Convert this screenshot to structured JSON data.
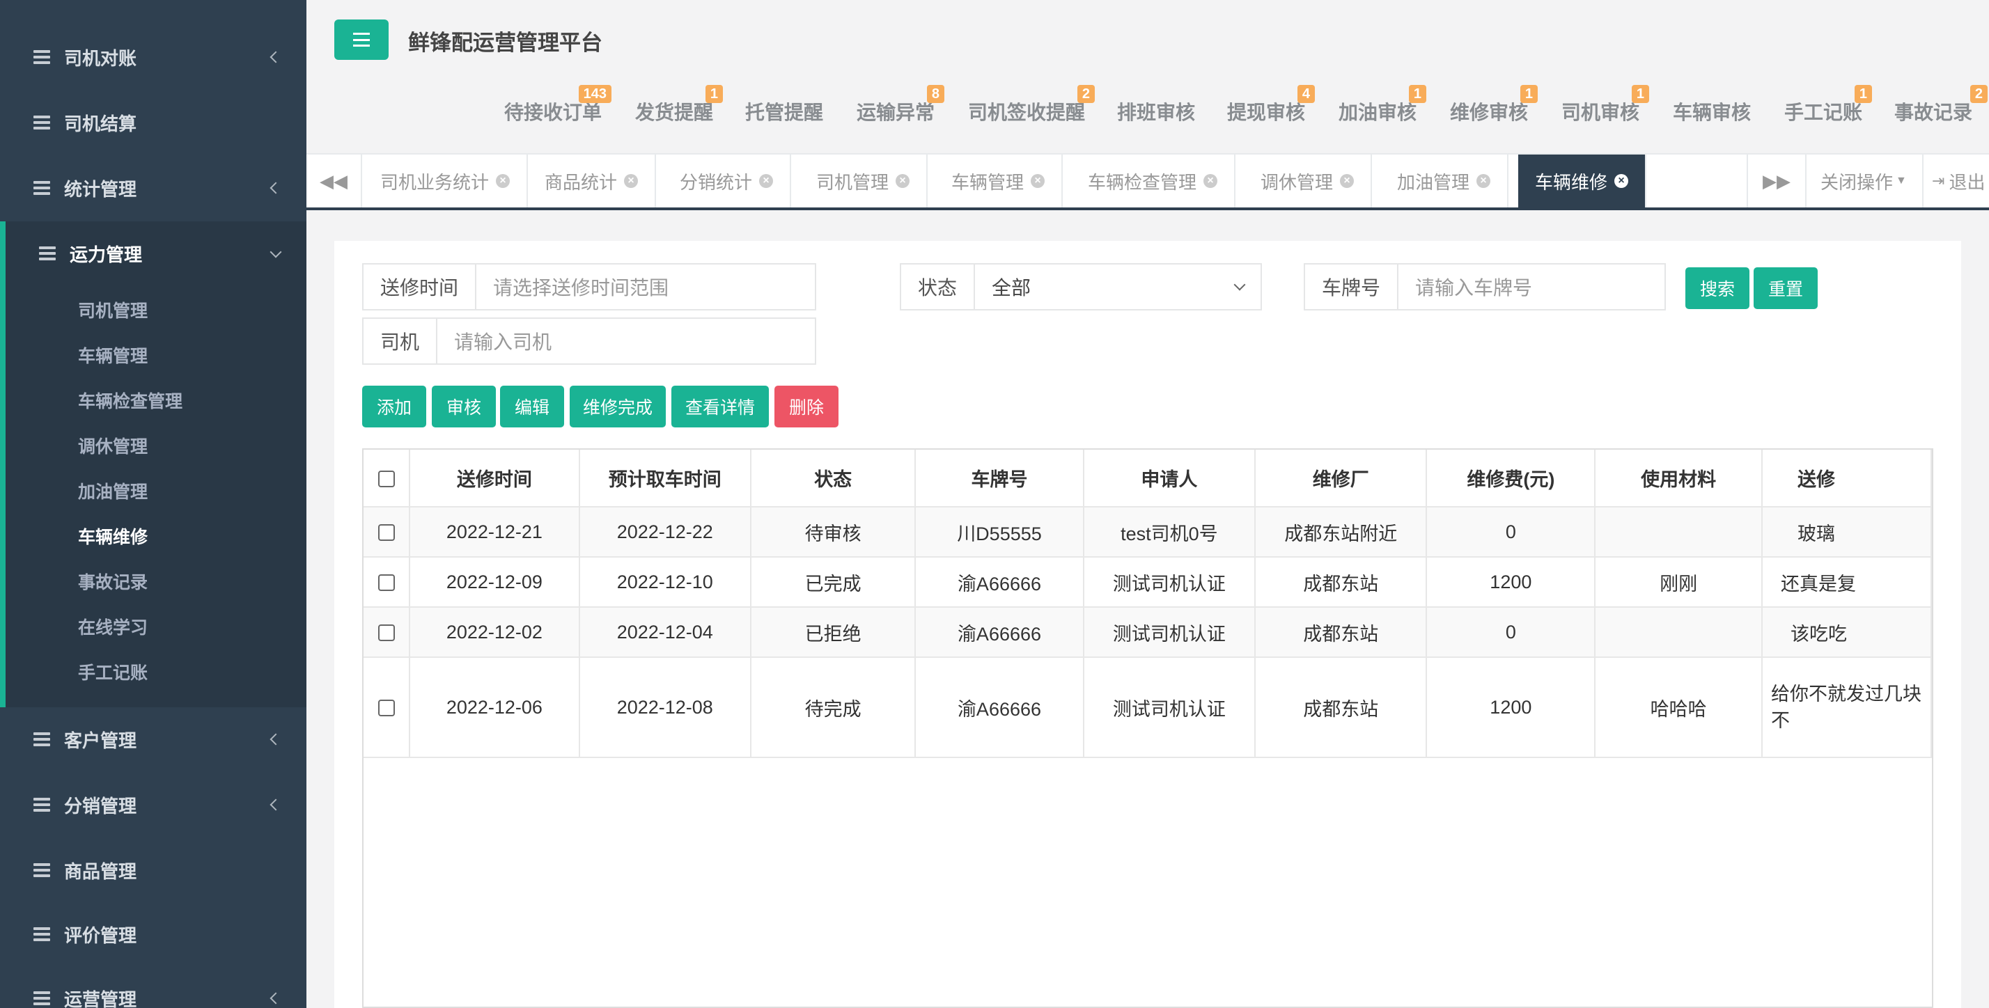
{
  "app_title": "鲜锋配运营管理平台",
  "colors": {
    "sidebar_bg": "#2f4050",
    "accent": "#1ab394",
    "danger": "#ed5565",
    "badge": "#f8ac59"
  },
  "sidebar": {
    "items": [
      {
        "label": "司机对账",
        "has_children": true
      },
      {
        "label": "司机结算",
        "has_children": false
      },
      {
        "label": "统计管理",
        "has_children": true
      },
      {
        "label": "运力管理",
        "has_children": true,
        "expanded": true
      },
      {
        "label": "客户管理",
        "has_children": true
      },
      {
        "label": "分销管理",
        "has_children": true
      },
      {
        "label": "商品管理",
        "has_children": false
      },
      {
        "label": "评价管理",
        "has_children": false
      },
      {
        "label": "运营管理",
        "has_children": true
      }
    ],
    "sub_items": [
      "司机管理",
      "车辆管理",
      "车辆检查管理",
      "调休管理",
      "加油管理",
      "车辆维修",
      "事故记录",
      "在线学习",
      "手工记账"
    ],
    "current_sub": "车辆维修"
  },
  "notifications": [
    {
      "label": "待接收订单",
      "badge": "143"
    },
    {
      "label": "发货提醒",
      "badge": "1"
    },
    {
      "label": "托管提醒",
      "badge": ""
    },
    {
      "label": "运输异常",
      "badge": "8"
    },
    {
      "label": "司机签收提醒",
      "badge": "2"
    },
    {
      "label": "排班审核",
      "badge": ""
    },
    {
      "label": "提现审核",
      "badge": "4"
    },
    {
      "label": "加油审核",
      "badge": "1"
    },
    {
      "label": "维修审核",
      "badge": "1"
    },
    {
      "label": "司机审核",
      "badge": "1"
    },
    {
      "label": "车辆审核",
      "badge": ""
    },
    {
      "label": "手工记账",
      "badge": "1"
    },
    {
      "label": "事故记录",
      "badge": "2"
    }
  ],
  "tabs": [
    "司机业务统计",
    "商品统计",
    "分销统计",
    "司机管理",
    "车辆管理",
    "车辆检查管理",
    "调休管理",
    "加油管理",
    "车辆维修"
  ],
  "active_tab": "车辆维修",
  "tab_actions": {
    "close_ops": "关闭操作",
    "logout": "退出"
  },
  "filters": {
    "repair_time": {
      "label": "送修时间",
      "placeholder": "请选择送修时间范围"
    },
    "status": {
      "label": "状态",
      "value": "全部"
    },
    "plate": {
      "label": "车牌号",
      "placeholder": "请输入车牌号"
    },
    "driver": {
      "label": "司机",
      "placeholder": "请输入司机"
    },
    "search_btn": "搜索",
    "reset_btn": "重置"
  },
  "toolbar": {
    "add": "添加",
    "audit": "审核",
    "edit": "编辑",
    "complete": "维修完成",
    "detail": "查看详情",
    "delete": "删除"
  },
  "table": {
    "headers": [
      "送修时间",
      "预计取车时间",
      "状态",
      "车牌号",
      "申请人",
      "维修厂",
      "维修费(元)",
      "使用材料",
      "送修"
    ],
    "rows": [
      [
        "2022-12-21",
        "2022-12-22",
        "待审核",
        "川D55555",
        "test司机0号",
        "成都东站附近",
        "0",
        "",
        "玻璃"
      ],
      [
        "2022-12-09",
        "2022-12-10",
        "已完成",
        "渝A66666",
        "测试司机认证",
        "成都东站",
        "1200",
        "刚刚",
        "还真是复"
      ],
      [
        "2022-12-02",
        "2022-12-04",
        "已拒绝",
        "渝A66666",
        "测试司机认证",
        "成都东站",
        "0",
        "",
        "该吃吃"
      ],
      [
        "2022-12-06",
        "2022-12-08",
        "待完成",
        "渝A66666",
        "测试司机认证",
        "成都东站",
        "1200",
        "哈哈哈",
        "给你不就发过几块不"
      ]
    ]
  }
}
